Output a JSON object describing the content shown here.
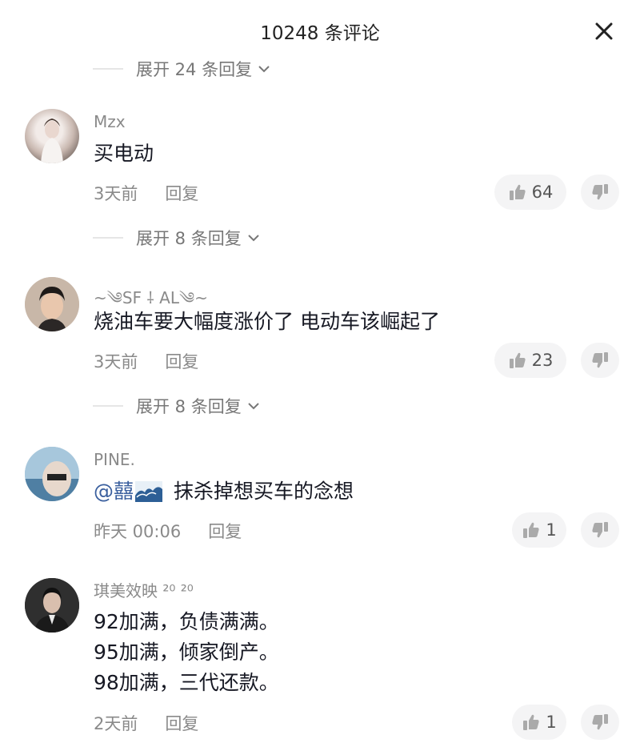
{
  "header": {
    "title": "10248 条评论"
  },
  "expand_top": {
    "label": "展开 24 条回复"
  },
  "comments": [
    {
      "username": "Mzx",
      "text": "买电动",
      "time": "3天前",
      "reply_label": "回复",
      "likes": "64",
      "expand_label": "展开 8 条回复"
    },
    {
      "username": "~༄SF ⸸ AL༄~",
      "text": "烧油车要大幅度涨价了 电动车该崛起了",
      "time": "3天前",
      "reply_label": "回复",
      "likes": "23",
      "expand_label": "展开 8 条回复"
    },
    {
      "username": "PINE.",
      "mention": "@囍",
      "text": "抹杀掉想买车的念想",
      "time": "昨天 00:06",
      "reply_label": "回复",
      "likes": "1"
    },
    {
      "username": "琪美效映 ²⁰ ²⁰",
      "lines": [
        "92加满，负债满满。",
        "95加满，倾家倒产。",
        "98加满，三代还款。"
      ],
      "time": "2天前",
      "reply_label": "回复",
      "likes": "1"
    }
  ],
  "colors": {
    "mention": "#3a5f9e",
    "text": "#161823",
    "muted": "#8a8a8a",
    "pill": "#f4f4f5"
  }
}
